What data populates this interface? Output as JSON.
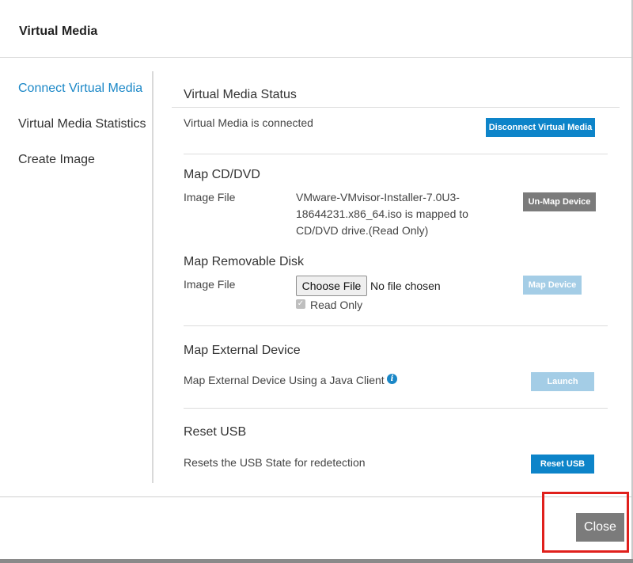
{
  "dialog": {
    "title": "Virtual Media"
  },
  "sidebar": {
    "items": [
      {
        "label": "Connect Virtual Media",
        "active": true
      },
      {
        "label": "Virtual Media Statistics",
        "active": false
      },
      {
        "label": "Create Image",
        "active": false
      }
    ]
  },
  "status": {
    "title": "Virtual Media Status",
    "text": "Virtual Media is connected",
    "disconnect_label": "Disconnect Virtual Media"
  },
  "cd_dvd": {
    "title": "Map CD/DVD",
    "image_file_label": "Image File",
    "mapped_line1": "VMware-VMvisor-Installer-7.0U3-",
    "mapped_line2": "18644231.x86_64.iso is mapped to",
    "mapped_line3": "CD/DVD drive.(Read Only)",
    "unmap_label": "Un-Map Device"
  },
  "removable": {
    "title": "Map Removable Disk",
    "image_file_label": "Image File",
    "choose_file_label": "Choose File",
    "no_file_text": "No file chosen",
    "read_only_label": "Read Only",
    "read_only_checked": true,
    "map_label": "Map Device"
  },
  "external": {
    "title": "Map External Device",
    "text": "Map External Device Using a Java Client",
    "info_icon": "info-icon",
    "launch_label": "Launch"
  },
  "reset_usb": {
    "title": "Reset USB",
    "text": "Resets the USB State for redetection",
    "button_label": "Reset USB"
  },
  "footer": {
    "close_label": "Close"
  },
  "colors": {
    "accent": "#1a87c7",
    "primary_button": "#0d84c9",
    "gray_button": "#7b7b7b",
    "disabled_button": "#a4cde6",
    "highlight": "#e0201c"
  }
}
